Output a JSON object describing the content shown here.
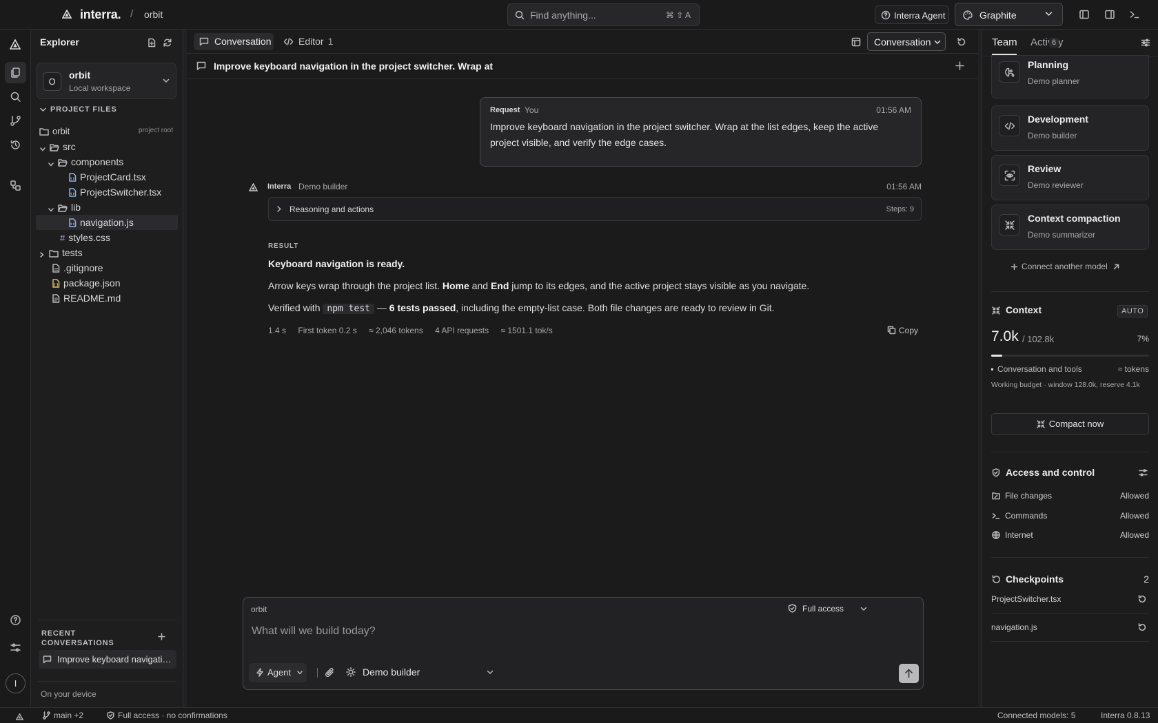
{
  "app": {
    "brand": "interra.",
    "breadcrumb_sep": "/",
    "project": "orbit",
    "search_placeholder": "Find anything...",
    "search_shortcut": "⌘ ⇧ A",
    "agent_button": "Interra Agent",
    "theme": "Graphite"
  },
  "explorer": {
    "title": "Explorer",
    "workspace": {
      "initial": "O",
      "name": "orbit",
      "sub": "Local workspace"
    },
    "project_files_label": "PROJECT FILES",
    "root": {
      "name": "orbit",
      "tag": "project root"
    },
    "files": {
      "src": "src",
      "components": "components",
      "project_card": "ProjectCard.tsx",
      "project_switcher": "ProjectSwitcher.tsx",
      "lib": "lib",
      "navigation": "navigation.js",
      "styles": "styles.css",
      "tests": "tests",
      "gitignore": ".gitignore",
      "package": "package.json",
      "readme": "README.md"
    },
    "recent_label": "RECENT CONVERSATIONS",
    "recent_item": "Improve keyboard navigation in the project switcher",
    "on_device": "On your device"
  },
  "tabs": {
    "conversation": "Conversation",
    "editor": "Editor",
    "editor_count": "1",
    "view_select": "Conversation"
  },
  "conversation": {
    "title": "Improve keyboard navigation in the project switcher. Wrap at",
    "request": {
      "tag": "Request",
      "who": "You",
      "time": "01:56 AM",
      "text": "Improve keyboard navigation in the project switcher. Wrap at the list edges, keep the active project visible, and verify the edge cases."
    },
    "response": {
      "name": "Interra",
      "agent": "Demo builder",
      "time": "01:56 AM",
      "reasoning_label": "Reasoning and actions",
      "steps": "Steps: 9",
      "result_tag": "RESULT",
      "result_title": "Keyboard navigation is ready.",
      "p1_a": "Arrow keys wrap through the project list. ",
      "p1_home": "Home",
      "p1_b": " and ",
      "p1_end": "End",
      "p1_c": " jump to its edges, and the active project stays visible as you navigate.",
      "p2_a": "Verified with ",
      "p2_code": "npm test",
      "p2_b": " — ",
      "p2_bold": "6 tests passed",
      "p2_c": ", including the empty-list case. Both file changes are ready to review in Git.",
      "stats": {
        "duration": "1.4 s",
        "first_token": "First token 0.2 s",
        "tokens": "≈ 2,046 tokens",
        "requests": "4 API requests",
        "rate": "≈ 1501.1 tok/s"
      },
      "copy_label": "Copy"
    }
  },
  "composer": {
    "project": "orbit",
    "access": "Full access",
    "placeholder": "What will we build today?",
    "mode": "Agent",
    "model": "Demo builder"
  },
  "right": {
    "tab_team": "Team",
    "tab_activity": "Activity",
    "activity_count": "6",
    "models": [
      {
        "title": "Planning",
        "sub": "Demo planner"
      },
      {
        "title": "Development",
        "sub": "Demo builder"
      },
      {
        "title": "Review",
        "sub": "Demo reviewer"
      },
      {
        "title": "Context compaction",
        "sub": "Demo summarizer"
      }
    ],
    "connect_label": "Connect another model",
    "context": {
      "title": "Context",
      "mode": "AUTO",
      "used": "7.0k",
      "total": "/ 102.8k",
      "percent": "7%",
      "fill_fraction": 0.07,
      "legend": "Conversation and tools",
      "legend_right": "≈ tokens",
      "budget": "Working budget · window 128.0k, reserve 4.1k",
      "compact": "Compact now"
    },
    "access": {
      "title": "Access and control",
      "rows": [
        {
          "label": "File changes",
          "value": "Allowed"
        },
        {
          "label": "Commands",
          "value": "Allowed"
        },
        {
          "label": "Internet",
          "value": "Allowed"
        }
      ]
    },
    "checkpoints": {
      "title": "Checkpoints",
      "count": "2",
      "items": [
        "ProjectSwitcher.tsx",
        "navigation.js"
      ]
    }
  },
  "status": {
    "branch": "main +2",
    "access": "Full access · no confirmations",
    "models": "Connected models: 5",
    "version": "Interra 0.8.13"
  }
}
